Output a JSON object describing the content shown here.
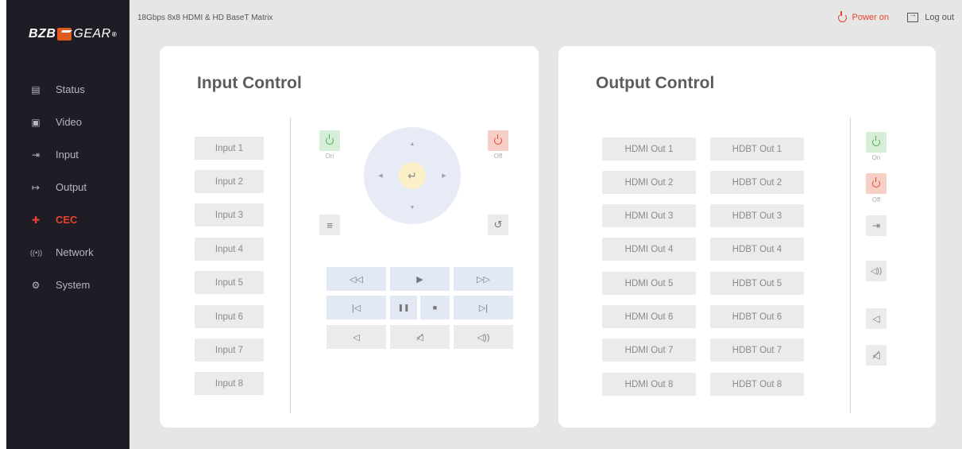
{
  "brand": {
    "part1": "BZB",
    "part2": "GEAR",
    "reg": "®"
  },
  "nav": [
    {
      "label": "Status",
      "icon": "document-icon",
      "glyph": "▤"
    },
    {
      "label": "Video",
      "icon": "video-icon",
      "glyph": "▶"
    },
    {
      "label": "Input",
      "icon": "input-icon",
      "glyph": "⇥"
    },
    {
      "label": "Output",
      "icon": "output-icon",
      "glyph": "↦"
    },
    {
      "label": "CEC",
      "icon": "cec-icon",
      "glyph": "✚",
      "active": true
    },
    {
      "label": "Network",
      "icon": "network-icon",
      "glyph": "((•))"
    },
    {
      "label": "System",
      "icon": "gear-icon",
      "glyph": "⚙"
    }
  ],
  "header": {
    "device_title": "18Gbps 8x8 HDMI & HD BaseT Matrix",
    "power_label": "Power on",
    "logout_label": "Log out"
  },
  "input_control": {
    "title": "Input Control",
    "inputs": [
      "Input 1",
      "Input 2",
      "Input 3",
      "Input 4",
      "Input 5",
      "Input 6",
      "Input 7",
      "Input 8"
    ],
    "on_label": "On",
    "off_label": "Off",
    "controls": {
      "rewind": "◁◁",
      "play": "▶",
      "fast_forward": "▷▷",
      "prev": "|◁",
      "pause": "❚❚",
      "stop": "■",
      "next": "▷|",
      "vol_down": "◁",
      "mute": "◁⃠",
      "vol_up": "◁))"
    }
  },
  "output_control": {
    "title": "Output Control",
    "hdmi_outputs": [
      "HDMI Out 1",
      "HDMI Out 2",
      "HDMI Out 3",
      "HDMI Out 4",
      "HDMI Out 5",
      "HDMI Out 6",
      "HDMI Out 7",
      "HDMI Out 8"
    ],
    "hdbt_outputs": [
      "HDBT Out 1",
      "HDBT Out 2",
      "HDBT Out 3",
      "HDBT Out 4",
      "HDBT Out 5",
      "HDBT Out 6",
      "HDBT Out 7",
      "HDBT Out 8"
    ],
    "on_label": "On",
    "off_label": "Off"
  },
  "colors": {
    "accent": "#e8432c",
    "sidebar": "#1f1c26",
    "power_on": "#4caf50"
  }
}
